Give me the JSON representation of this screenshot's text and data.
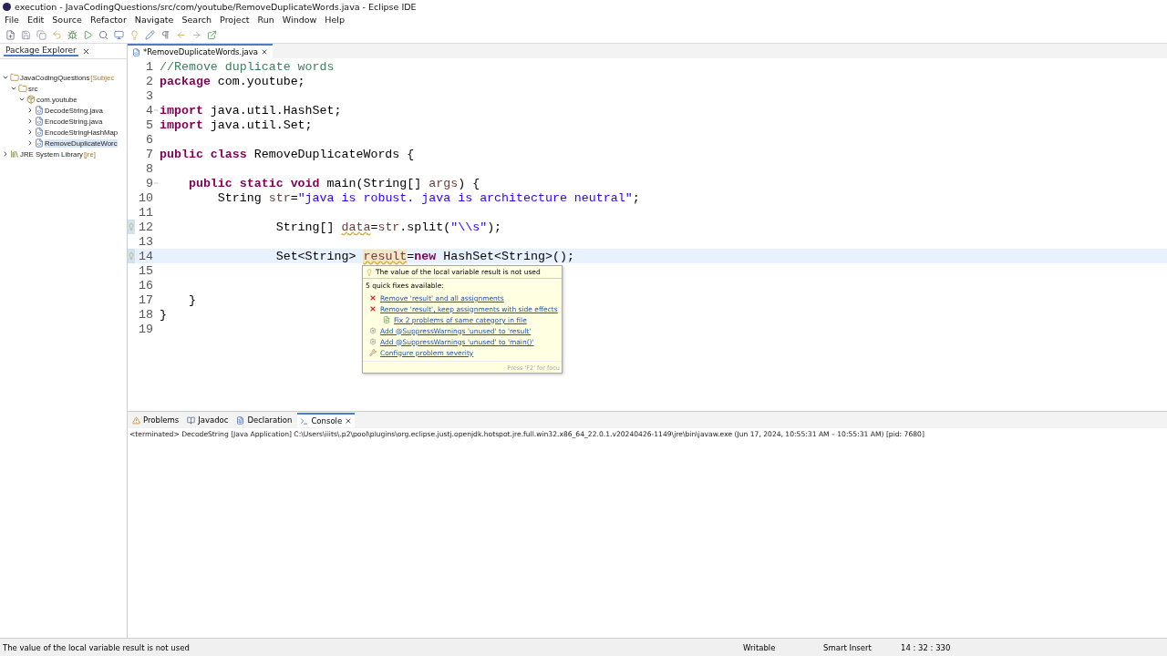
{
  "window": {
    "title": "execution - JavaCodingQuestions/src/com/youtube/RemoveDuplicateWords.java - Eclipse IDE"
  },
  "menu": [
    "File",
    "Edit",
    "Source",
    "Refactor",
    "Navigate",
    "Search",
    "Project",
    "Run",
    "Window",
    "Help"
  ],
  "explorer": {
    "title": "Package Explorer",
    "tree": [
      {
        "label": "JavaCodingQuestions",
        "suffix": "[Subjec",
        "kind": "project",
        "expanded": true,
        "children": [
          {
            "label": "src",
            "kind": "folder",
            "expanded": true,
            "children": [
              {
                "label": "com.youtube",
                "kind": "package",
                "expanded": true,
                "children": [
                  {
                    "label": "DecodeString.java",
                    "kind": "file",
                    "expanded": false,
                    "selected": false
                  },
                  {
                    "label": "EncodeString.java",
                    "kind": "file",
                    "expanded": false,
                    "selected": false
                  },
                  {
                    "label": "EncodeStringHashMap",
                    "kind": "file",
                    "expanded": false,
                    "selected": false
                  },
                  {
                    "label": "RemoveDuplicateWorc",
                    "kind": "file",
                    "expanded": false,
                    "selected": true
                  }
                ]
              }
            ]
          }
        ]
      },
      {
        "label": "JRE System Library",
        "suffix": "[jre]",
        "kind": "library",
        "expanded": false
      }
    ]
  },
  "editor": {
    "tab": {
      "label": "*RemoveDuplicateWords.java",
      "selected": true
    },
    "lines": [
      {
        "number": "1",
        "tokens": [
          {
            "kind": "cm",
            "text": "//Remove duplicate words"
          }
        ]
      },
      {
        "number": "2",
        "tokens": [
          {
            "kind": "kw",
            "text": "package"
          },
          {
            "kind": "tx",
            "text": " com.youtube;"
          }
        ]
      },
      {
        "number": "3"
      },
      {
        "number": "4",
        "fold": true,
        "tokens": [
          {
            "kind": "kw",
            "text": "import"
          },
          {
            "kind": "tx",
            "text": " java.util.HashSet;"
          }
        ]
      },
      {
        "number": "5",
        "tokens": [
          {
            "kind": "kw",
            "text": "import"
          },
          {
            "kind": "tx",
            "text": " java.util.Set;"
          }
        ]
      },
      {
        "number": "6"
      },
      {
        "number": "7",
        "tokens": [
          {
            "kind": "kw",
            "text": "public class"
          },
          {
            "kind": "tx",
            "text": " RemoveDuplicateWords {"
          }
        ]
      },
      {
        "number": "8"
      },
      {
        "number": "9",
        "fold": true,
        "tokens": [
          {
            "kind": "kw",
            "text": "    public static void"
          },
          {
            "kind": "tx",
            "text": " main(String[] "
          },
          {
            "kind": "var",
            "text": "args"
          },
          {
            "kind": "tx",
            "text": ") {"
          }
        ]
      },
      {
        "number": "10",
        "tokens": [
          {
            "kind": "tx",
            "text": "        String "
          },
          {
            "kind": "var",
            "text": "str"
          },
          {
            "kind": "tx",
            "text": "="
          },
          {
            "kind": "str",
            "text": "\"java is robust. java is architecture neutral\""
          },
          {
            "kind": "tx",
            "text": ";"
          }
        ]
      },
      {
        "number": "11"
      },
      {
        "number": "12",
        "warning": true,
        "tokens": [
          {
            "kind": "tx",
            "text": "                String[] "
          },
          {
            "kind": "unused",
            "text": "data"
          },
          {
            "kind": "tx",
            "text": "="
          },
          {
            "kind": "var",
            "text": "str"
          },
          {
            "kind": "tx",
            "text": ".split("
          },
          {
            "kind": "str",
            "text": "\"\\\\s\""
          },
          {
            "kind": "tx",
            "text": ");"
          }
        ]
      },
      {
        "number": "13"
      },
      {
        "number": "14",
        "warning": true,
        "current": true,
        "tokens": [
          {
            "kind": "tx",
            "text": "                Set<String> "
          },
          {
            "kind": "hl",
            "text": "result"
          },
          {
            "kind": "tx",
            "text": "="
          },
          {
            "kind": "kw",
            "text": "new"
          },
          {
            "kind": "tx",
            "text": " HashSet<String>();"
          }
        ]
      },
      {
        "number": "15"
      },
      {
        "number": "16"
      },
      {
        "number": "17",
        "tokens": [
          {
            "kind": "tx",
            "text": "    }"
          }
        ]
      },
      {
        "number": "18",
        "tokens": [
          {
            "kind": "tx",
            "text": "}"
          }
        ]
      },
      {
        "number": "19"
      }
    ]
  },
  "quickfix": {
    "title": "The value of the local variable result is not used",
    "subtitle": "5 quick fixes available:",
    "fixes": [
      {
        "kind": "remove",
        "label": "Remove 'result' and all assignments"
      },
      {
        "kind": "remove",
        "label": "Remove 'result', keep assignments with side effects"
      },
      {
        "kind": "file",
        "label": "Fix 2 problems of same category in file"
      },
      {
        "kind": "annotation",
        "label": "Add @SuppressWarnings 'unused' to 'result'"
      },
      {
        "kind": "annotation",
        "label": "Add @SuppressWarnings 'unused' to 'main()'"
      },
      {
        "kind": "config",
        "label": "Configure problem severity"
      }
    ],
    "footer": "Press 'F2' for focu"
  },
  "bottom": {
    "tabs": [
      {
        "label": "Problems",
        "selected": false
      },
      {
        "label": "Javadoc",
        "selected": false
      },
      {
        "label": "Declaration",
        "selected": false
      },
      {
        "label": "Console",
        "selected": true
      }
    ],
    "console": "<terminated> DecodeString [Java Application] C:\\Users\\iiits\\.p2\\pool\\plugins\\org.eclipse.justj.openjdk.hotspot.jre.full.win32.x86_64_22.0.1.v20240426-1149\\jre\\bin\\javaw.exe  (Jun 17, 2024, 10:55:31 AM – 10:55:31 AM) [pid: 7680]"
  },
  "status_bar": {
    "message": "The value of the local variable result is not used",
    "mode": "Writable",
    "insert": "Smart Insert",
    "position": "14 : 32 : 330"
  }
}
